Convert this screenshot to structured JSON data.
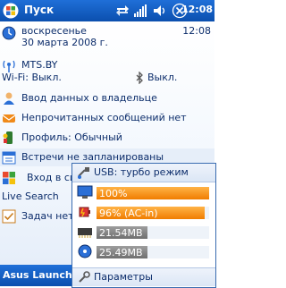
{
  "taskbar": {
    "start_label": "Пуск",
    "time": "12:08",
    "icons": [
      "usb-sync-icon",
      "signal-icon",
      "volume-icon",
      "close-icon"
    ]
  },
  "today": {
    "date": {
      "weekday": "воскресенье",
      "full": "30 марта 2008 г.",
      "time": "12:08"
    },
    "network": {
      "operator": "MTS.BY",
      "wifi": "Wi-Fi: Выкл.",
      "bluetooth": "Выкл."
    },
    "items": [
      {
        "label": "Ввод данных о владельце",
        "icon": "owner-icon"
      },
      {
        "label": "Непрочитанных сообщений нет",
        "icon": "messages-icon"
      },
      {
        "label": "Профиль: Обычный",
        "icon": "profile-icon"
      },
      {
        "label": "Встречи не запланированы",
        "icon": "calendar-icon"
      },
      {
        "label": "Вход в си",
        "icon": "windows-live-icon"
      },
      {
        "label": "Live Search",
        "icon": ""
      },
      {
        "label": "Задач нет",
        "icon": "tasks-icon"
      }
    ]
  },
  "bottombar": {
    "left_label": "Asus Launche"
  },
  "popup": {
    "usb_label": "USB: турбо режим",
    "rows": [
      {
        "label": "100%",
        "level": 1.0,
        "color": "#f07d00",
        "icon": "brightness-icon"
      },
      {
        "label": "96% (AC-in)",
        "level": 0.96,
        "color": "#f07d00",
        "icon": "battery-icon"
      },
      {
        "label": "21.54MB",
        "level": 0.45,
        "color": "#7a7a7a",
        "icon": "memory-icon"
      },
      {
        "label": "25.49MB",
        "level": 0.45,
        "color": "#7a7a7a",
        "icon": "storage-icon"
      }
    ],
    "params_label": "Параметры"
  }
}
